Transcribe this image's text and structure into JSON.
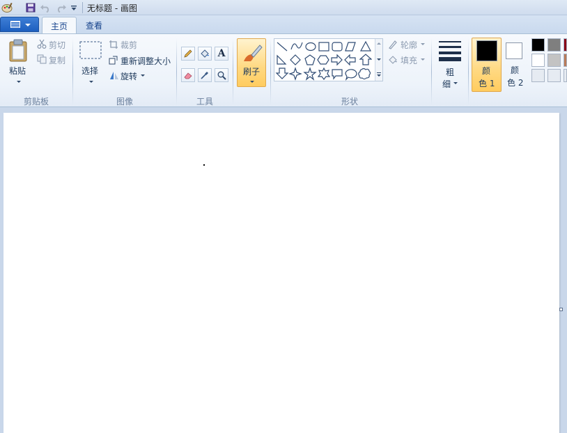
{
  "titlebar": {
    "title": "无标题 - 画图",
    "icons": [
      "paint-app-icon",
      "save-icon",
      "undo-icon",
      "redo-icon",
      "customize-quick-access-icon"
    ]
  },
  "tabs": [
    {
      "label": "主页",
      "active": true
    },
    {
      "label": "查看",
      "active": false
    }
  ],
  "ribbon": {
    "clipboard": {
      "group_label": "剪贴板",
      "paste": "粘贴",
      "cut": "剪切",
      "copy": "复制"
    },
    "image": {
      "group_label": "图像",
      "select": "选择",
      "crop": "裁剪",
      "resize": "重新调整大小",
      "rotate": "旋转"
    },
    "tools": {
      "group_label": "工具",
      "items": [
        "pencil-icon",
        "fill-bucket-icon",
        "text-icon",
        "eraser-icon",
        "color-picker-icon",
        "magnifier-icon"
      ],
      "text_glyph": "A"
    },
    "brushes": {
      "label": "刷子"
    },
    "shapes": {
      "group_label": "形状",
      "outline": "轮廓",
      "fill": "填充"
    },
    "size": {
      "label_line1": "粗",
      "label_line2": "细"
    },
    "colors": {
      "color1_line1": "颜",
      "color1_line2": "色 1",
      "color2_line1": "颜",
      "color2_line2": "色 2",
      "color1_value": "#000000",
      "color2_value": "#ffffff",
      "palette": [
        [
          "#000000",
          "#7f7f7f",
          "#880015"
        ],
        [
          "#ffffff",
          "#c3c3c3",
          "#b97a57"
        ],
        [
          "#e6ebf2",
          "#e6ebf2",
          "#e6ebf2"
        ]
      ]
    }
  }
}
